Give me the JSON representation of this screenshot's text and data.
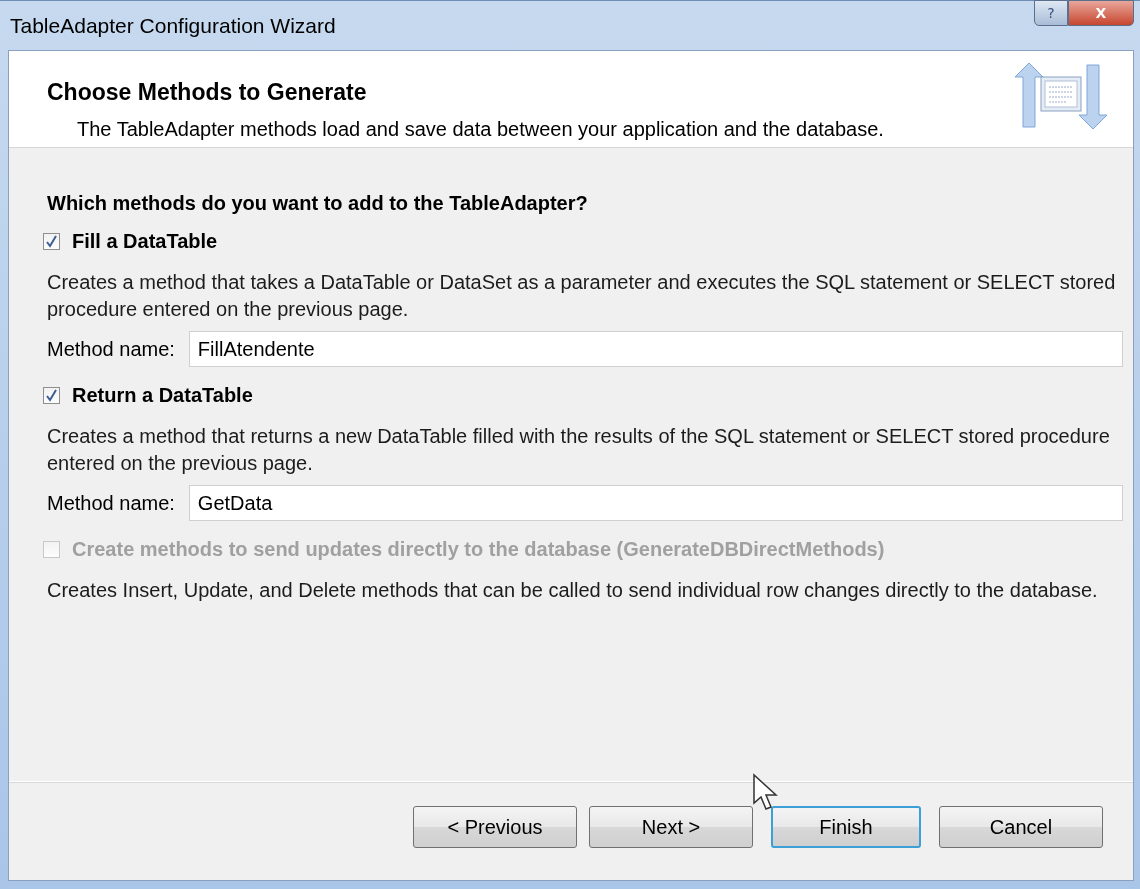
{
  "window": {
    "title": "TableAdapter Configuration Wizard",
    "controls": [
      {
        "kind": "help",
        "label": "?"
      },
      {
        "kind": "close",
        "label": "X"
      }
    ]
  },
  "header": {
    "title": "Choose Methods to Generate",
    "subtitle": "The TableAdapter methods load and save data between your application and the database."
  },
  "question": "Which methods do you want to add to the TableAdapter?",
  "options": [
    {
      "label": "Fill a DataTable",
      "checked": true,
      "disabled": false,
      "description": "Creates a method that takes a DataTable or DataSet as a parameter and executes the SQL statement or SELECT stored procedure entered on the previous page.",
      "field": {
        "label": "Method name:",
        "value": "FillAtendente"
      }
    },
    {
      "label": "Return a DataTable",
      "checked": true,
      "disabled": false,
      "description": "Creates a method that returns a new DataTable filled with the results of the SQL statement or SELECT stored procedure entered on the previous page.",
      "field": {
        "label": "Method name:",
        "value": "GetData"
      }
    },
    {
      "label": "Create methods to send updates directly to the database (GenerateDBDirectMethods)",
      "checked": false,
      "disabled": true,
      "description": "Creates Insert, Update, and Delete methods that can be called to send individual row changes directly to the database."
    }
  ],
  "buttons": [
    {
      "label": "< Previous",
      "default": false
    },
    {
      "label": "Next >",
      "default": false
    },
    {
      "label": "Finish",
      "default": true
    },
    {
      "label": "Cancel",
      "default": false
    }
  ]
}
